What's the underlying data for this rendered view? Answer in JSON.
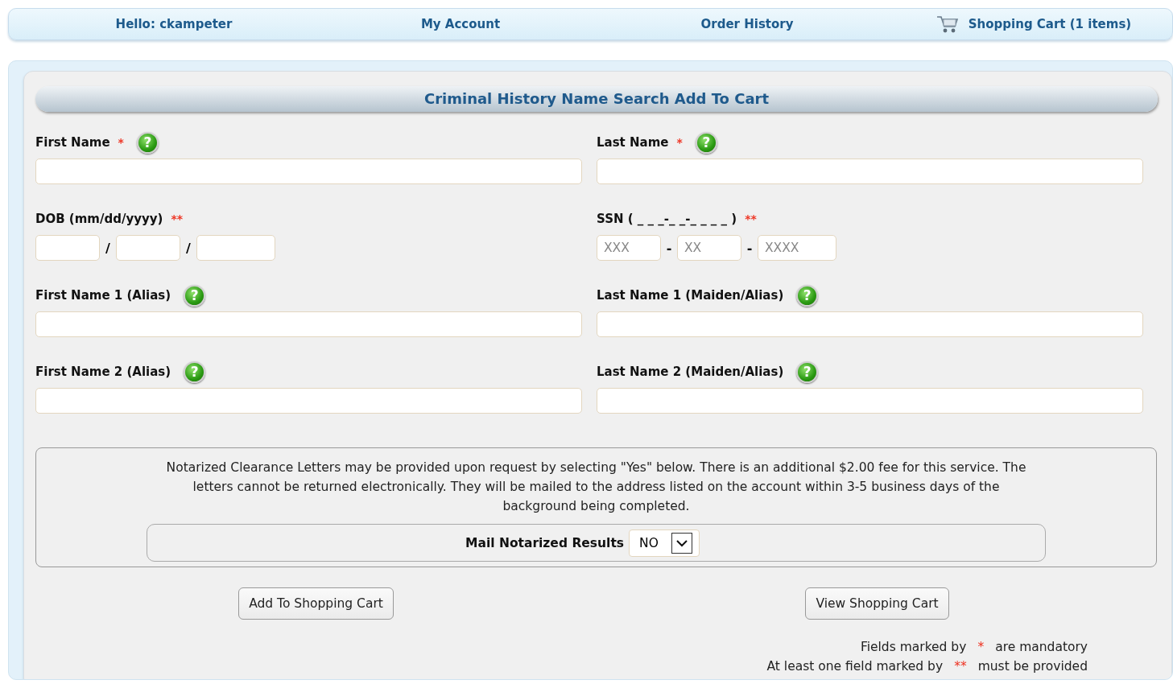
{
  "nav": [
    {
      "text": "Hello: ckampeter",
      "kind": "greeting"
    },
    {
      "text": "My Account",
      "kind": "link"
    },
    {
      "text": "Order History",
      "kind": "link"
    },
    {
      "text": "Shopping Cart (1 items)",
      "kind": "cart"
    }
  ],
  "title": "Criminal History Name Search Add To Cart",
  "fields": [
    {
      "label": "First Name",
      "marker": "*",
      "help": "?",
      "kind": "text"
    },
    {
      "label": "Last Name",
      "marker": "*",
      "help": "?",
      "kind": "text"
    },
    {
      "label": "DOB (mm/dd/yyyy)",
      "marker": "**",
      "kind": "split",
      "separators": [
        "/",
        "/"
      ]
    },
    {
      "label": "SSN ( _ _ _-_ _-_ _ _ _ )",
      "marker": "**",
      "kind": "split",
      "separators": [
        "-",
        "-"
      ],
      "parts": [
        {
          "placeholder": "XXX"
        },
        {
          "placeholder": "XX"
        },
        {
          "placeholder": "XXXX"
        }
      ]
    },
    {
      "label": "First Name 1 (Alias)",
      "help": "?",
      "kind": "text"
    },
    {
      "label": "Last Name 1 (Maiden/Alias)",
      "help": "?",
      "kind": "text"
    },
    {
      "label": "First Name 2 (Alias)",
      "help": "?",
      "kind": "text"
    },
    {
      "label": "Last Name 2 (Maiden/Alias)",
      "help": "?",
      "kind": "text"
    }
  ],
  "notice": {
    "text": "Notarized Clearance Letters may be provided upon request by selecting \"Yes\" below. There is an additional $2.00 fee for this service. The letters cannot be returned electronically. They will be mailed to the address listed on the account within 3-5 business days of the background being completed.",
    "select": {
      "label": "Mail Notarized Results",
      "value": "NO"
    }
  },
  "buttons": [
    "Add To Shopping Cart",
    "View Shopping Cart"
  ],
  "notes": [
    {
      "before": "Fields marked by",
      "marker": "*",
      "after": "are mandatory"
    },
    {
      "before": "At least one field marked by",
      "marker": "**",
      "after": "must be provided"
    }
  ]
}
